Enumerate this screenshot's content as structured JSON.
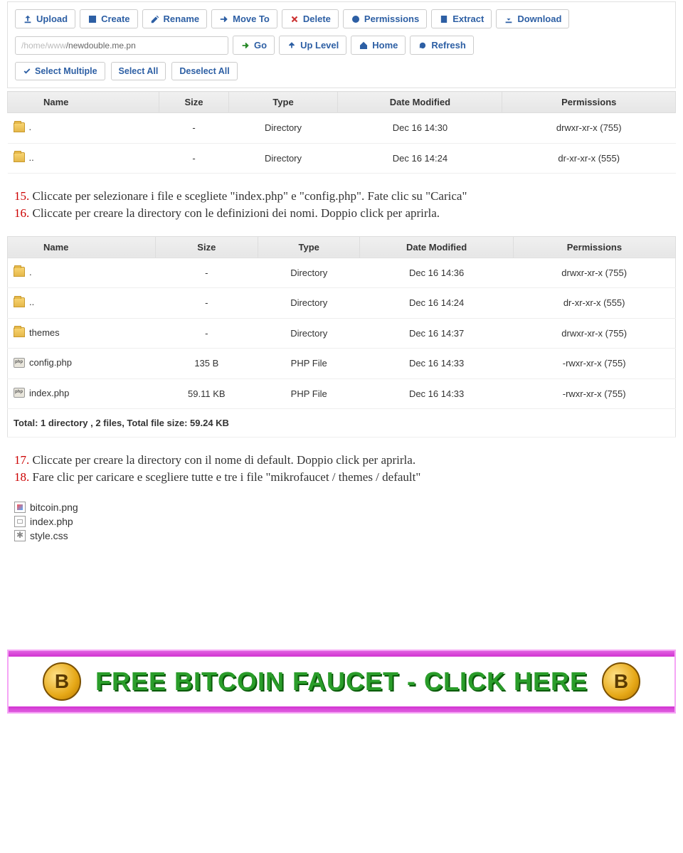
{
  "toolbar": {
    "upload": "Upload",
    "create": "Create",
    "rename": "Rename",
    "moveto": "Move To",
    "delete": "Delete",
    "permissions": "Permissions",
    "extract": "Extract",
    "download": "Download"
  },
  "path": {
    "prefix": "/home/www",
    "current": "/newdouble.me.pn"
  },
  "nav": {
    "go": "Go",
    "uplevel": "Up Level",
    "home": "Home",
    "refresh": "Refresh"
  },
  "sel": {
    "multi": "Select Multiple",
    "all": "Select All",
    "none": "Deselect All"
  },
  "table1": {
    "headers": {
      "name": "Name",
      "size": "Size",
      "type": "Type",
      "date": "Date Modified",
      "perm": "Permissions"
    },
    "rows": [
      {
        "icon": "folder",
        "name": ".",
        "size": "-",
        "type": "Directory",
        "date": "Dec 16 14:30",
        "perm": "drwxr-xr-x (755)"
      },
      {
        "icon": "folder",
        "name": "..",
        "size": "-",
        "type": "Directory",
        "date": "Dec 16 14:24",
        "perm": "dr-xr-xr-x (555)"
      }
    ]
  },
  "instr1": {
    "n15": "15.",
    "t15": "Cliccate per selezionare i file e scegliete \"index.php\" e \"config.php\". Fate clic su \"Carica\"",
    "n16": "16.",
    "t16": "Cliccate per creare la directory con le definizioni dei nomi. Doppio click per aprirla."
  },
  "table2": {
    "headers": {
      "name": "Name",
      "size": "Size",
      "type": "Type",
      "date": "Date Modified",
      "perm": "Permissions"
    },
    "rows": [
      {
        "icon": "folder",
        "name": ".",
        "size": "-",
        "type": "Directory",
        "date": "Dec 16 14:36",
        "perm": "drwxr-xr-x (755)"
      },
      {
        "icon": "folder",
        "name": "..",
        "size": "-",
        "type": "Directory",
        "date": "Dec 16 14:24",
        "perm": "dr-xr-xr-x (555)"
      },
      {
        "icon": "folder",
        "name": "themes",
        "size": "-",
        "type": "Directory",
        "date": "Dec 16 14:37",
        "perm": "drwxr-xr-x (755)"
      },
      {
        "icon": "php",
        "name": "config.php",
        "size": "135 B",
        "type": "PHP File",
        "date": "Dec 16 14:33",
        "perm": "-rwxr-xr-x (755)"
      },
      {
        "icon": "php",
        "name": "index.php",
        "size": "59.11 KB",
        "type": "PHP File",
        "date": "Dec 16 14:33",
        "perm": "-rwxr-xr-x (755)"
      }
    ],
    "total": "Total: 1 directory , 2 files, Total file size: 59.24 KB"
  },
  "instr2": {
    "n17": "17.",
    "t17": "Cliccate per creare la directory con il nome di default. Doppio click per aprirla.",
    "n18": "18.",
    "t18": "Fare clic per caricare e scegliere tutte e tre i file \"mikrofaucet / themes / default\""
  },
  "filelist": [
    {
      "icon": "img",
      "name": "bitcoin.png"
    },
    {
      "icon": "php",
      "name": "index.php"
    },
    {
      "icon": "css",
      "name": "style.css"
    }
  ],
  "banner": {
    "text": "FREE BITCOIN FAUCET - CLICK HERE",
    "coin": "B"
  }
}
